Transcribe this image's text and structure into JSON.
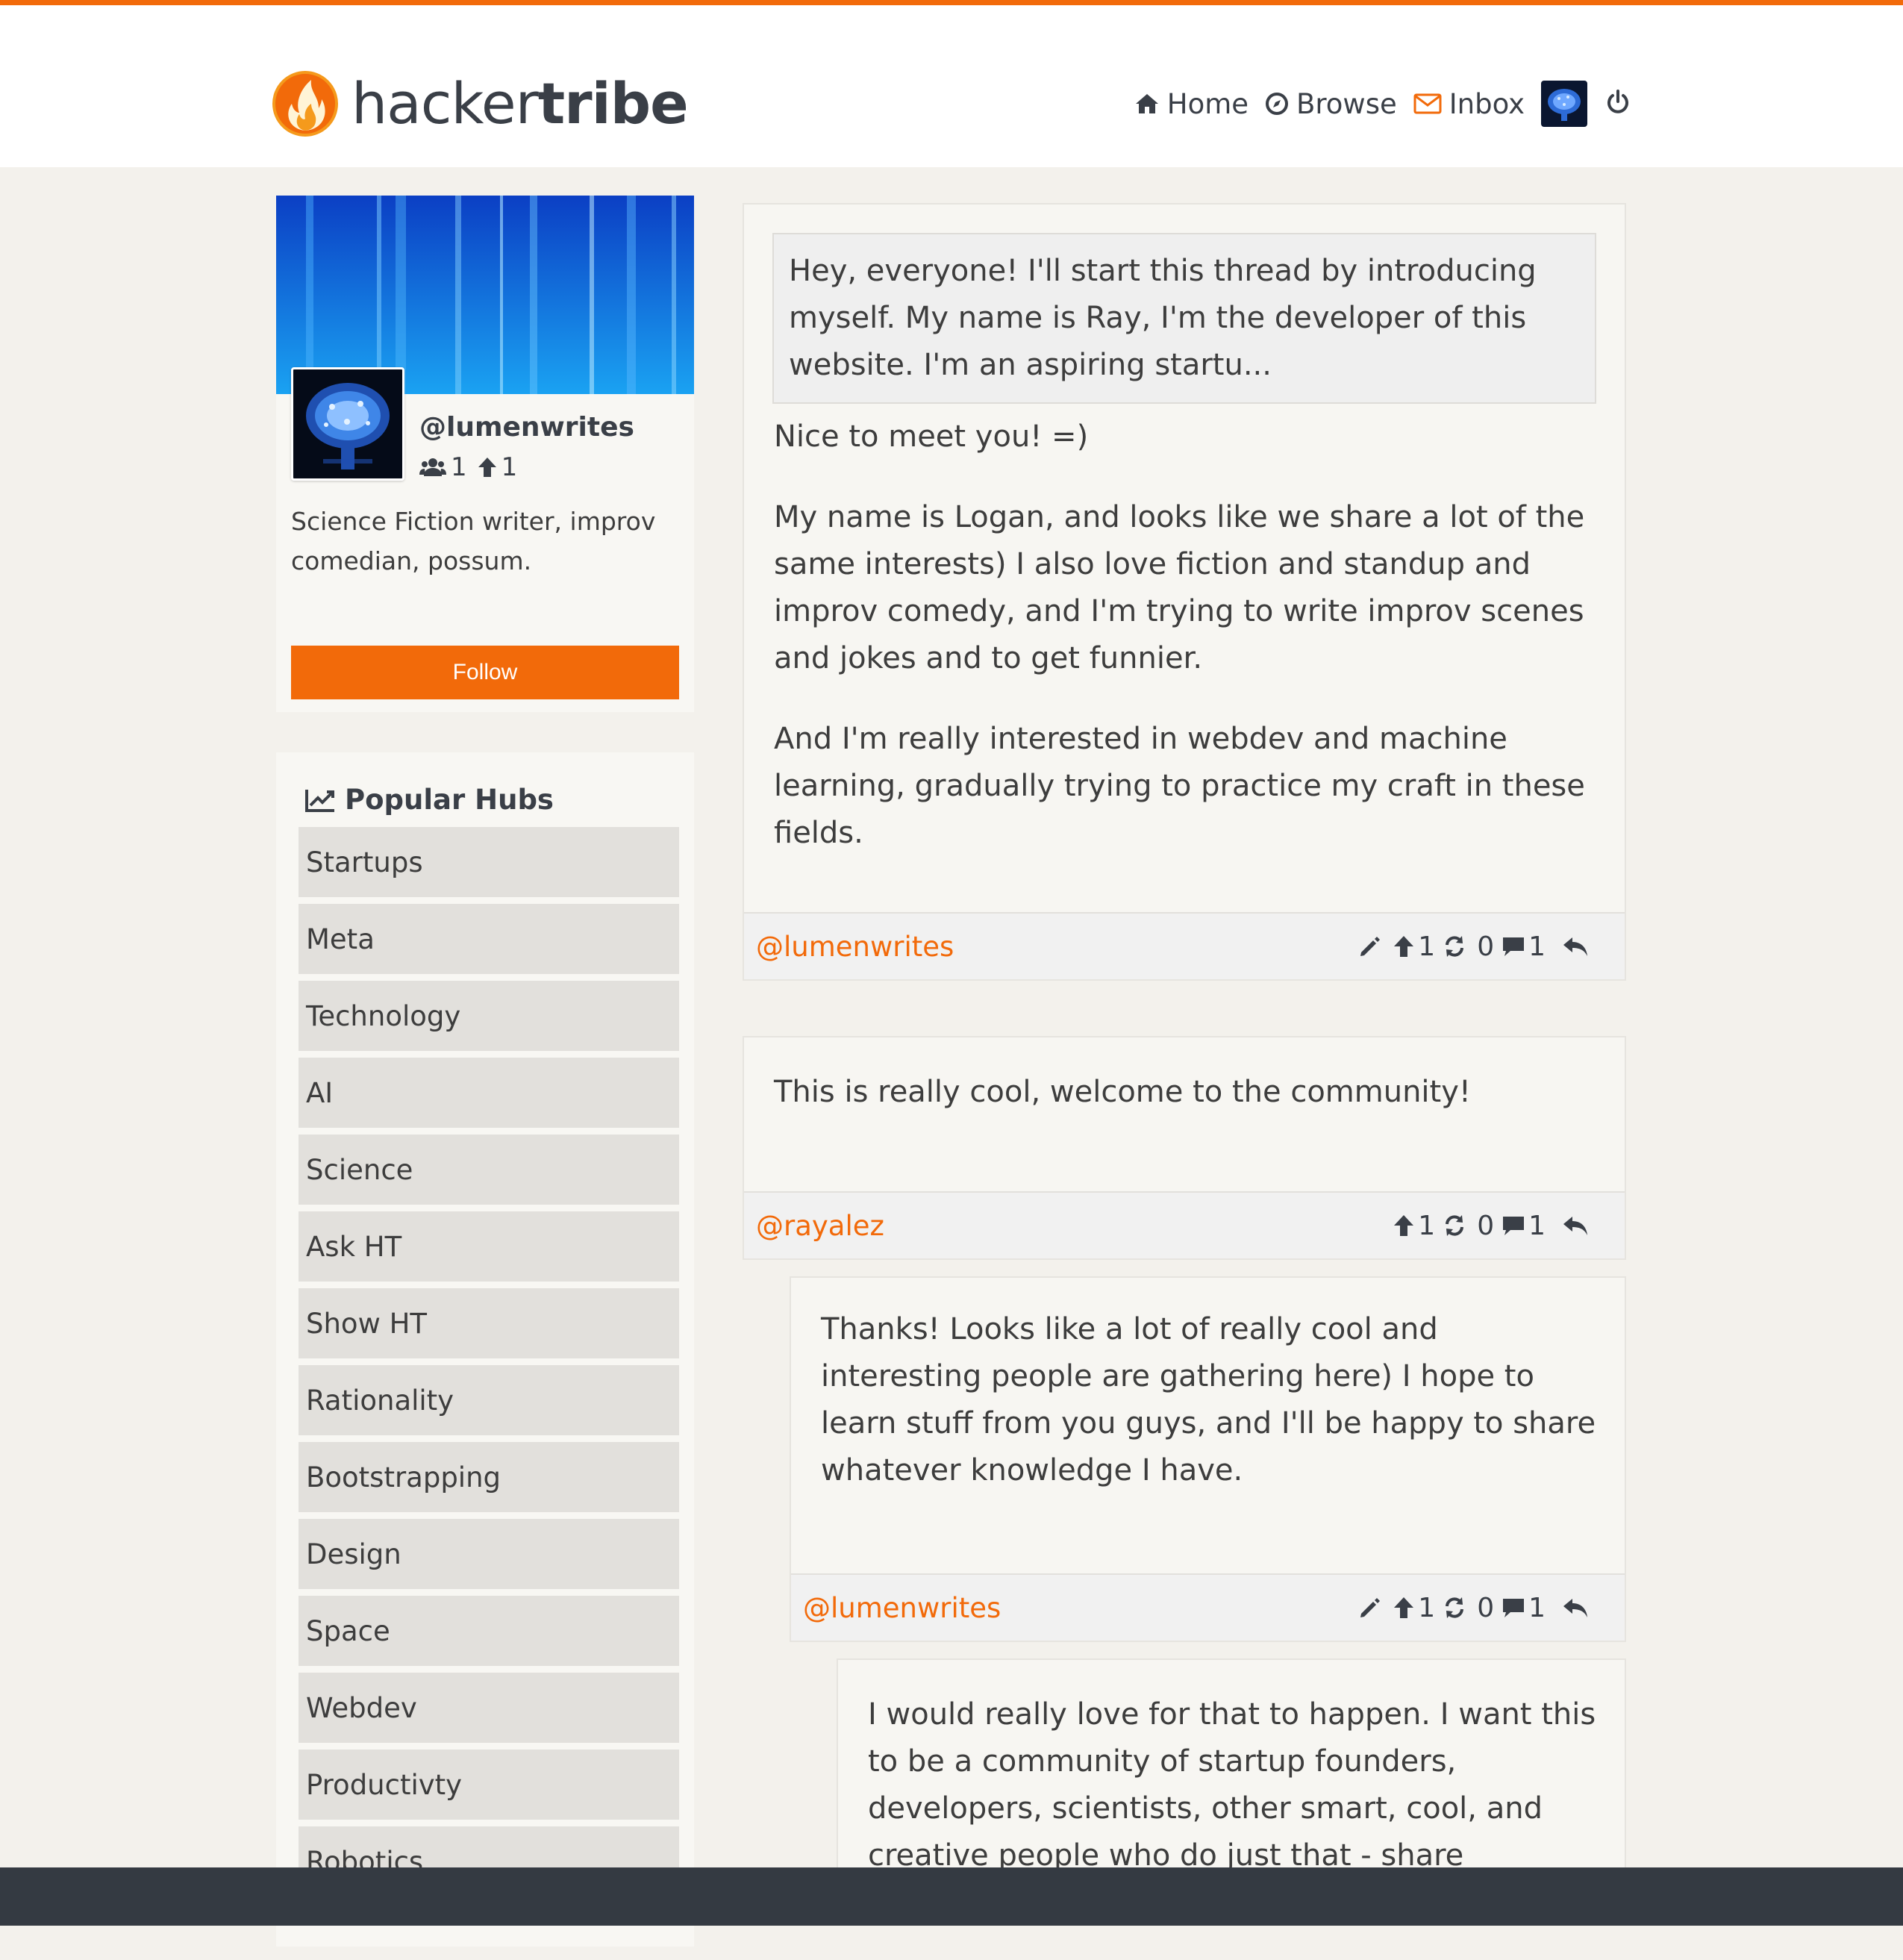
{
  "brand": {
    "name_light": "hacker",
    "name_bold": "tribe"
  },
  "nav": {
    "home": "Home",
    "browse": "Browse",
    "inbox": "Inbox"
  },
  "profile": {
    "username": "@lumenwrites",
    "followers": "1",
    "upvotes": "1",
    "bio": "Science Fiction writer, improv comedian, possum.",
    "follow_label": "Follow"
  },
  "hubs": {
    "title": "Popular Hubs",
    "items": [
      "Startups",
      "Meta",
      "Technology",
      "AI",
      "Science",
      "Ask HT",
      "Show HT",
      "Rationality",
      "Bootstrapping",
      "Design",
      "Space",
      "Webdev",
      "Productivty",
      "Robotics"
    ]
  },
  "posts": [
    {
      "quote": "Hey, everyone! I'll start this thread by introducing myself. My name is Ray, I'm the developer of this website. I'm an aspiring startu...",
      "paragraphs": [
        "Nice to meet you! =)",
        "My name is Logan, and looks like we share a lot of the same interests) I also love fiction and standup and improv comedy, and I'm trying to write improv scenes and jokes and to get funnier.",
        "And I'm really interested in webdev and machine learning, gradually trying to practice my craft in these fields."
      ],
      "author": "@lumenwrites",
      "upvotes": "1",
      "reposts": "0",
      "comments": "1"
    },
    {
      "paragraphs": [
        "This is really cool, welcome to the community!"
      ],
      "author": "@rayalez",
      "upvotes": "1",
      "reposts": "0",
      "comments": "1"
    },
    {
      "paragraphs": [
        "Thanks! Looks like a lot of really cool and interesting people are gathering here) I hope to learn stuff from you guys, and I'll be happy to share whatever knowledge I have."
      ],
      "author": "@lumenwrites",
      "upvotes": "1",
      "reposts": "0",
      "comments": "1"
    },
    {
      "paragraphs": [
        "I would really love for that to happen. I want this to be a community of startup founders, developers, scientists, other smart, cool, and creative people who do just that - share knowledge and help each"
      ]
    }
  ],
  "colors": {
    "accent": "#f26a0a",
    "footer": "#343a42",
    "background": "#f3f1ec"
  }
}
